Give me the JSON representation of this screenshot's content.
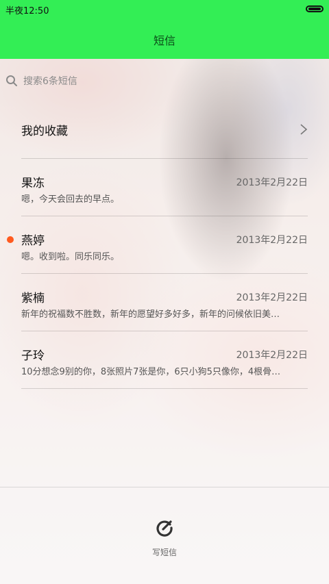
{
  "status": {
    "time": "半夜12:50"
  },
  "title": "短信",
  "search": {
    "placeholder": "搜索6条短信"
  },
  "favorites": {
    "label": "我的收藏"
  },
  "threads": [
    {
      "name": "果冻",
      "date": "2013年2月22日",
      "preview": "嗯，今天会回去的早点。",
      "unread": false
    },
    {
      "name": "燕婷",
      "date": "2013年2月22日",
      "preview": "嗯。收到啦。同乐同乐。",
      "unread": true
    },
    {
      "name": "紫楠",
      "date": "2013年2月22日",
      "preview": "新年的祝福数不胜数，新年的愿望好多好多，新年的问候依旧美…",
      "unread": false
    },
    {
      "name": "子玲",
      "date": "2013年2月22日",
      "preview": "10分想念9别的你，8张照片7张是你，6只小狗5只像你，4根骨…",
      "unread": false
    }
  ],
  "compose": {
    "label": "写短信"
  },
  "colors": {
    "header": "#33ee55",
    "unread_dot": "#ff5a1f"
  },
  "icons": [
    "battery-icon",
    "search-icon",
    "chevron-right-icon",
    "compose-icon"
  ]
}
